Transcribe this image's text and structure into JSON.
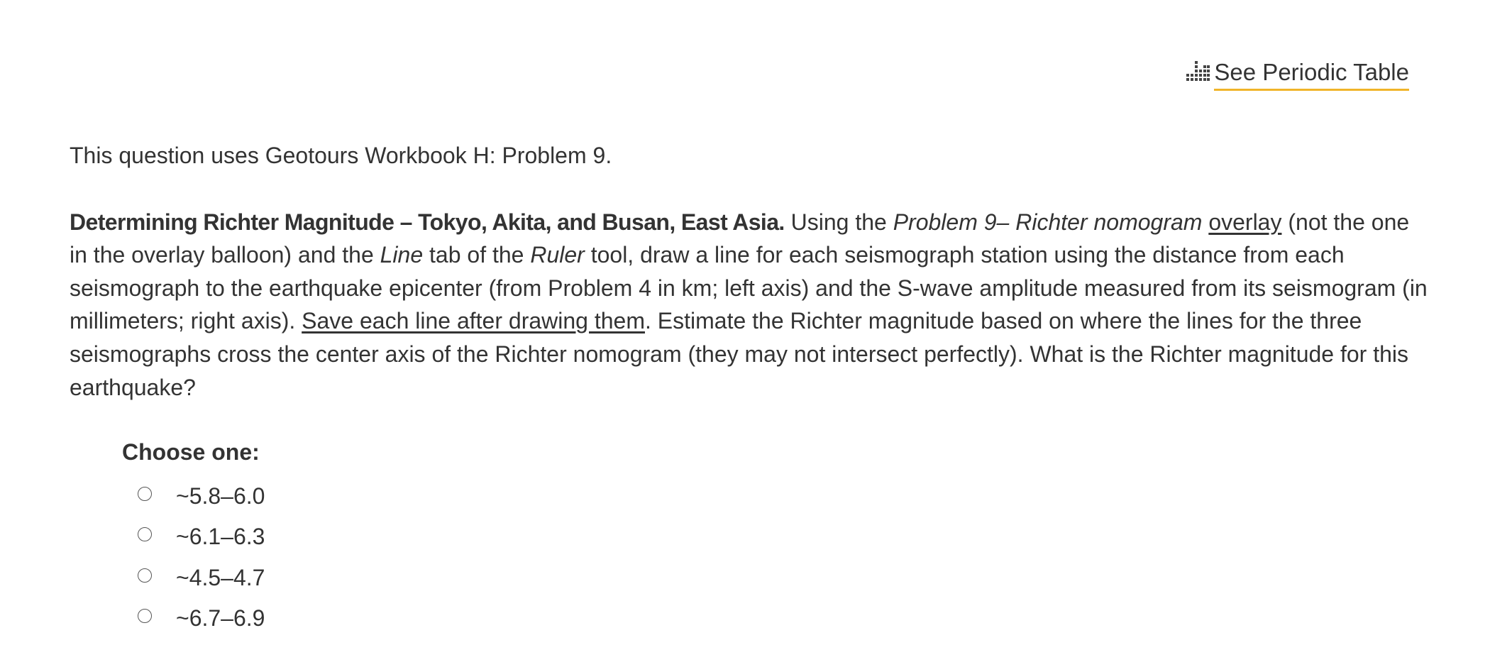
{
  "header": {
    "periodic_table_link": "See Periodic Table",
    "icon": "periodic-table-icon",
    "accent_color": "#f0b429"
  },
  "intro": "This question uses Geotours Workbook H: Problem 9.",
  "question": {
    "title": "Determining Richter Magnitude – Tokyo, Akita, and Busan, East Asia.",
    "t1": " Using the ",
    "overlay_name": "Problem 9– Richter nomogram",
    "t2": " ",
    "overlay_link": "overlay",
    "t3": " (not the one in the overlay balloon) and the ",
    "line_tab": "Line",
    "t4": " tab of the ",
    "ruler_tool": "Ruler",
    "t5": " tool, draw a line for each seismograph station using the distance from each seismograph to the earthquake epicenter (from Problem 4 in km; left axis) and the S-wave amplitude measured from its seismogram (in millimeters; right axis). ",
    "save_note": "Save each line after drawing them",
    "t6": ". Estimate the Richter magnitude based on where the lines for the three seismographs cross the center axis of the Richter nomogram (they may not intersect perfectly). What is the Richter magnitude for this earthquake?"
  },
  "choices": {
    "label": "Choose one:",
    "options": [
      {
        "text": "~5.8–6.0",
        "selected": false
      },
      {
        "text": "~6.1–6.3",
        "selected": false
      },
      {
        "text": "~4.5–4.7",
        "selected": false
      },
      {
        "text": "~6.7–6.9",
        "selected": false
      }
    ]
  }
}
